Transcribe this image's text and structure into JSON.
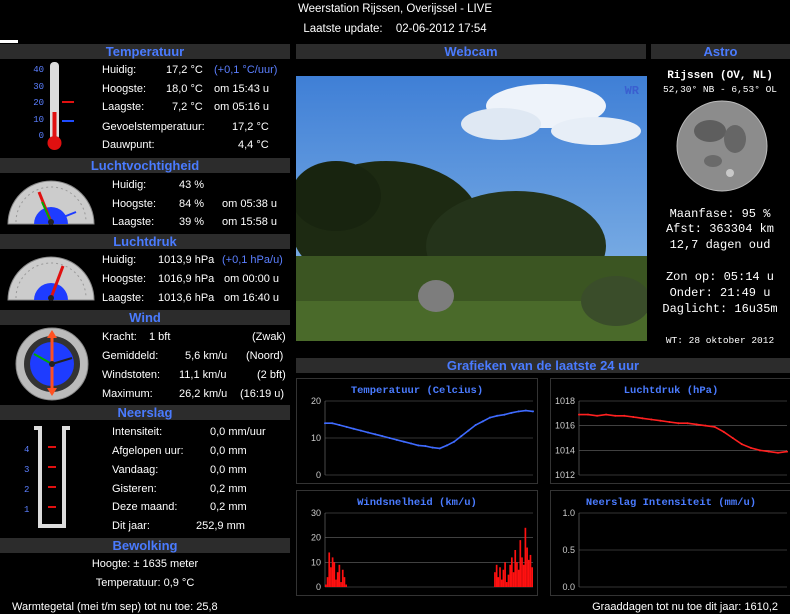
{
  "header": {
    "title": "Weerstation Rijssen, Overijssel - LIVE",
    "update_label": "Laatste update:",
    "update_value": "02-06-2012 17:54"
  },
  "temperature": {
    "section": "Temperatuur",
    "scale": [
      "40",
      "30",
      "20",
      "10",
      "0"
    ],
    "rows": [
      {
        "label": "Huidig:",
        "value": "17,2 °C",
        "extra": "(+0,1 °C/uur)"
      },
      {
        "label": "Hoogste:",
        "value": "18,0 °C",
        "extra": "om 15:43 u"
      },
      {
        "label": "Laagste:",
        "value": "7,2 °C",
        "extra": "om 05:16 u"
      },
      {
        "label": "Gevoelstemperatuur:",
        "value": "17,2 °C"
      },
      {
        "label": "Dauwpunt:",
        "value": "4,4 °C"
      }
    ]
  },
  "humidity": {
    "section": "Luchtvochtigheid",
    "rows": [
      {
        "label": "Huidig:",
        "value": "43 %",
        "extra": ""
      },
      {
        "label": "Hoogste:",
        "value": "84 %",
        "extra": "om 05:38 u"
      },
      {
        "label": "Laagste:",
        "value": "39 %",
        "extra": "om 15:58 u"
      }
    ]
  },
  "pressure": {
    "section": "Luchtdruk",
    "rows": [
      {
        "label": "Huidig:",
        "value": "1013,9 hPa",
        "extra": "(+0,1 hPa/u)"
      },
      {
        "label": "Hoogste:",
        "value": "1016,9 hPa",
        "extra": "om 00:00 u"
      },
      {
        "label": "Laagste:",
        "value": "1013,6 hPa",
        "extra": "om 16:40 u"
      }
    ]
  },
  "wind": {
    "section": "Wind",
    "rows": [
      {
        "label": "Kracht:",
        "value": "1 bft",
        "extra": "(Zwak)"
      },
      {
        "label": "Gemiddeld:",
        "value": "5,6 km/u",
        "extra": "(Noord)"
      },
      {
        "label": "Windstoten:",
        "value": "11,1 km/u",
        "extra": "(2 bft)"
      },
      {
        "label": "Maximum:",
        "value": "26,2 km/u",
        "extra": "(16:19 u)"
      }
    ]
  },
  "rain": {
    "section": "Neerslag",
    "scale": [
      "4",
      "3",
      "2",
      "1"
    ],
    "rows": [
      {
        "label": "Intensiteit:",
        "value": "0,0 mm/uur"
      },
      {
        "label": "Afgelopen uur:",
        "value": "0,0 mm"
      },
      {
        "label": "Vandaag:",
        "value": "0,0 mm"
      },
      {
        "label": "Gisteren:",
        "value": "0,2 mm"
      },
      {
        "label": "Deze maand:",
        "value": "0,2 mm"
      },
      {
        "label": "Dit jaar:",
        "value": "252,9 mm"
      }
    ]
  },
  "clouds": {
    "section": "Bewolking",
    "height": "Hoogte: ± 1635 meter",
    "temp": "Temperatuur: 0,9 °C"
  },
  "webcam": {
    "section": "Webcam",
    "logo": "WR"
  },
  "astro": {
    "section": "Astro",
    "place": "Rijssen (OV, NL)",
    "coords": "52,30° NB - 6,53° OL",
    "phase": "Maanfase: 95 %",
    "distance": "Afst: 363304 km",
    "age": "12,7 dagen oud",
    "sunrise": "Zon op: 05:14 u",
    "sunset": "Onder: 21:49 u",
    "daylight": "Daglicht: 16u35m",
    "credit": "WT: 28 oktober 2012"
  },
  "graphs": {
    "section": "Grafieken van de laatste 24 uur"
  },
  "footer": {
    "left": "Warmtegetal (mei t/m sep) tot nu toe: 25,8",
    "right": "Graaddagen tot nu toe dit jaar: 1610,2"
  },
  "chart_data": [
    {
      "type": "line",
      "title": "Temperatuur (Celcius)",
      "ylim": [
        0,
        20
      ],
      "yticks": [
        "20",
        "10",
        "0"
      ],
      "color": "#3f6bff",
      "values": [
        14,
        14,
        13.5,
        13,
        12.5,
        12,
        11.5,
        11,
        10.5,
        10,
        9.5,
        9,
        8.5,
        8,
        7.8,
        7.4,
        7.2,
        8,
        9,
        10.5,
        12,
        13.5,
        14.5,
        15.5,
        16,
        16.3,
        16.8,
        17.2,
        17.4,
        17.2
      ]
    },
    {
      "type": "line",
      "title": "Luchtdruk (hPa)",
      "ylim": [
        1012,
        1018
      ],
      "yticks": [
        "1018",
        "1016",
        "1014",
        "1012"
      ],
      "color": "#ff2020",
      "values": [
        1016.9,
        1016.9,
        1016.8,
        1016.9,
        1016.8,
        1016.8,
        1016.7,
        1016.6,
        1016.5,
        1016.4,
        1016.3,
        1016.2,
        1016.2,
        1016.1,
        1016,
        1015.9,
        1015.5,
        1015,
        1014.5,
        1014.2,
        1014,
        1013.9,
        1013.8,
        1013.9
      ]
    },
    {
      "type": "bar",
      "title": "Windsnelheid (km/u)",
      "ylim": [
        0,
        30
      ],
      "yticks": [
        "30",
        "20",
        "10",
        "0"
      ],
      "color": "#ff1010",
      "values": [
        1,
        4,
        14,
        8,
        12,
        10,
        3,
        6,
        9,
        2,
        7,
        4,
        1,
        0,
        0,
        0,
        0,
        0,
        0,
        0,
        0,
        0,
        0,
        0,
        0,
        0,
        0,
        0,
        0,
        0,
        0,
        0,
        0,
        0,
        0,
        0,
        0,
        0,
        0,
        0,
        0,
        0,
        0,
        0,
        0,
        0,
        0,
        0,
        0,
        0,
        0,
        0,
        0,
        0,
        0,
        0,
        0,
        0,
        0,
        0,
        0,
        0,
        0,
        0,
        0,
        0,
        0,
        0,
        0,
        0,
        0,
        0,
        0,
        0,
        0,
        0,
        0,
        0,
        0,
        0,
        0,
        0,
        0,
        0,
        0,
        0,
        0,
        0,
        0,
        0,
        0,
        0,
        0,
        0,
        0,
        0,
        0,
        0,
        0,
        0,
        6,
        9,
        4,
        8,
        3,
        7,
        10,
        2,
        5,
        9,
        12,
        6,
        15,
        10,
        7,
        19,
        12,
        9,
        24,
        16,
        11,
        13,
        8
      ]
    },
    {
      "type": "bar",
      "title": "Neerslag Intensiteit (mm/u)",
      "ylim": [
        0,
        1
      ],
      "yticks": [
        "1.0",
        "0.5",
        "0.0"
      ],
      "color": "#ff1010",
      "values": []
    }
  ]
}
